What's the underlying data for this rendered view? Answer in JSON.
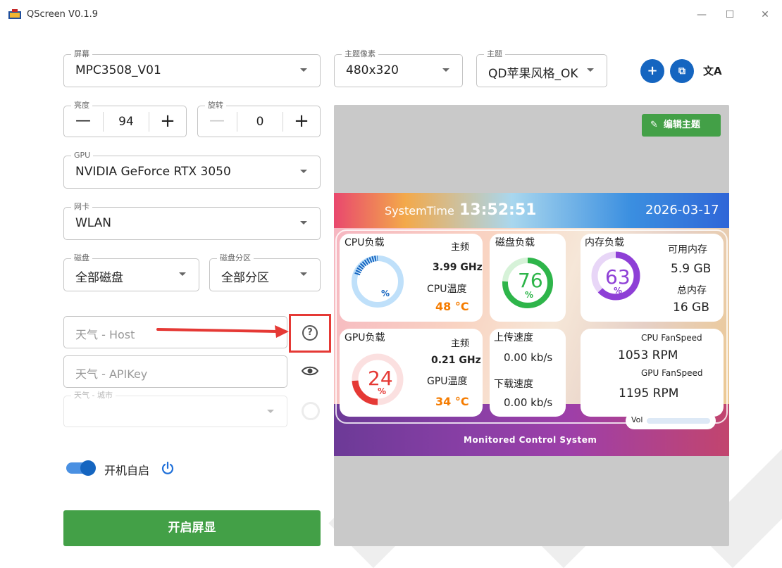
{
  "window": {
    "title": "QScreen V0.1.9",
    "minimize": "—",
    "maximize": "☐",
    "close": "✕"
  },
  "screen_select": {
    "label": "屏幕",
    "value": "MPC3508_V01"
  },
  "resolution_select": {
    "label": "主题像素",
    "value": "480x320"
  },
  "theme_select": {
    "label": "主题",
    "value": "QD苹果风格_OK"
  },
  "theme_actions": {
    "add": "+",
    "import": "⧉",
    "translate": "文A"
  },
  "brightness": {
    "label": "亮度",
    "value": "94",
    "minus": "—",
    "plus": "+"
  },
  "rotation": {
    "label": "旋转",
    "value": "0",
    "minus": "—",
    "plus": "+"
  },
  "gpu_select": {
    "label": "GPU",
    "value": "NVIDIA GeForce RTX 3050"
  },
  "network_select": {
    "label": "网卡",
    "value": "WLAN"
  },
  "disk_select": {
    "label": "磁盘",
    "value": "全部磁盘"
  },
  "partition_select": {
    "label": "磁盘分区",
    "value": "全部分区"
  },
  "weather_host": {
    "placeholder": "天气 - Host",
    "help_icon": "?"
  },
  "weather_apikey": {
    "placeholder": "天气 - APIKey"
  },
  "weather_city": {
    "label": "天气 - 城市"
  },
  "autostart": {
    "label": "开机自启",
    "checked": true
  },
  "start_button": "开启屏显",
  "edit_theme_button": "编辑主题",
  "edit_theme_icon": "✎",
  "preview": {
    "system_time_label": "SystemTime",
    "time": "13:52:51",
    "date": "2026-03-17",
    "cpu": {
      "title": "CPU负载",
      "freq_label": "主频",
      "freq": "3.99 GHz",
      "temp_label": "CPU温度",
      "temp": "48 °C",
      "load_unit": "%",
      "load_percent": 0
    },
    "disk": {
      "title": "磁盘负载",
      "value": "76",
      "unit": "%",
      "percent": 76
    },
    "memory": {
      "title": "内存负载",
      "value": "63",
      "unit": "%",
      "percent": 63,
      "avail_label": "可用内存",
      "avail": "5.9 GB",
      "total_label": "总内存",
      "total": "16 GB"
    },
    "gpu": {
      "title": "GPU负载",
      "freq_label": "主频",
      "freq": "0.21 GHz",
      "temp_label": "GPU温度",
      "temp": "34 °C",
      "value": "24",
      "unit": "%",
      "percent": 24
    },
    "network": {
      "up_label": "上传速度",
      "up": "0.00 kb/s",
      "down_label": "下载速度",
      "down": "0.00 kb/s"
    },
    "fans": {
      "cpu_label": "CPU FanSpeed",
      "cpu": "1053 RPM",
      "gpu_label": "GPU FanSpeed",
      "gpu": "1195 RPM"
    },
    "vol_label": "Vol",
    "footer": "Monitored Control System"
  },
  "colors": {
    "accent_blue": "#1565c0",
    "green_button": "#43a047",
    "annotation_red": "#e53935"
  }
}
